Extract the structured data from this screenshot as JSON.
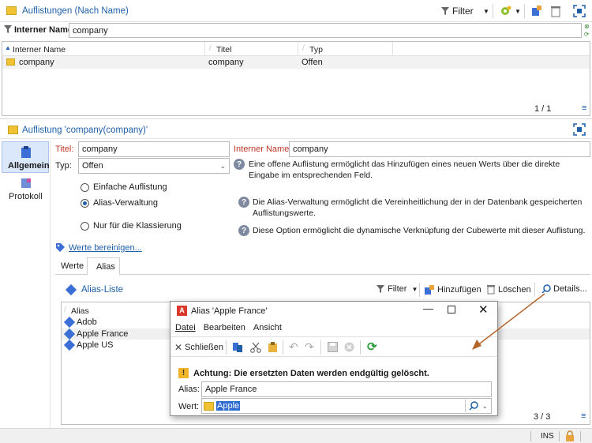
{
  "listings_panel": {
    "title": "Auflistungen (Nach Name)",
    "filter_label": "Filter",
    "filter_field_label": "Interner Name:",
    "filter_value": "company",
    "columns": [
      "Interner Name",
      "Titel",
      "Typ"
    ],
    "rows": [
      {
        "name": "company",
        "title": "company",
        "type": "Offen"
      }
    ],
    "pager": "1 / 1"
  },
  "detail_panel": {
    "title": "Auflistung 'company(company)'",
    "tabs_side": [
      {
        "label": "Allgemein"
      },
      {
        "label": "Protokoll"
      }
    ],
    "titel_label": "Titel:",
    "titel_value": "company",
    "internal_label": "Interner Name:",
    "internal_value": "company",
    "typ_label": "Typ:",
    "typ_value": "Offen",
    "help_1": "Eine offene Auflistung ermöglicht das Hinzufügen eines neuen Werts über die direkte Eingabe im entsprechenden Feld.",
    "radio_1": "Einfache Auflistung",
    "radio_2": "Alias-Verwaltung",
    "radio_3": "Nur für die Klassierung",
    "help_2": "Die Alias-Verwaltung ermöglicht die Vereinheitlichung der in der Datenbank gespeicherten Auflistungswerte.",
    "help_3": "Diese Option ermöglicht die dynamische Verknüpfung der Cubewerte mit dieser Auflistung.",
    "clean_link": "Werte bereinigen...",
    "tabs": [
      "Werte",
      "Alias"
    ],
    "alias_list_title": "Alias-Liste",
    "filter_label": "Filter",
    "add_label": "Hinzufügen",
    "delete_label": "Löschen",
    "details_label": "Details...",
    "alias_header": "Alias",
    "aliases": [
      "Adob",
      "Apple France",
      "Apple US"
    ],
    "pager": "3 / 3"
  },
  "dialog": {
    "title": "Alias 'Apple France'",
    "menu": [
      "Datei",
      "Bearbeiten",
      "Ansicht"
    ],
    "close_label": "Schließen",
    "warning": "Achtung: Die ersetzten Daten werden endgültig gelöscht.",
    "alias_label": "Alias:",
    "alias_value": "Apple France",
    "value_label": "Wert:",
    "value_value": "Apple"
  },
  "status_bar": {
    "ins": "INS"
  },
  "colors": {
    "accent": "#1f5fa8",
    "selection": "#2e6bd1",
    "annotation_arrow": "#b5652a"
  }
}
